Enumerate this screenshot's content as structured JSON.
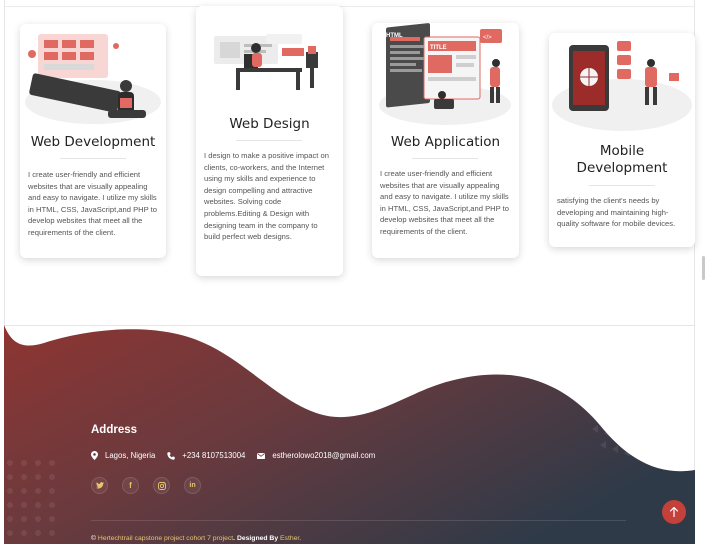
{
  "services": [
    {
      "title": "Web Development",
      "description": "I create user-friendly and efficient websites that are visually appealing and easy to navigate. I utilize my skills in HTML, CSS, JavaScript,and PHP to develop websites that meet all the requirements of the client.",
      "icon": "web-development-illustration"
    },
    {
      "title": "Web Design",
      "description": "I design to make a positive impact on clients, co-workers, and the Internet using my skills and experience to design compelling and attractive websites. Solving code problems.Editing & Design with designing team in the company to build perfect web designs.",
      "icon": "web-design-illustration"
    },
    {
      "title": "Web Application",
      "description": "I create user-friendly and efficient websites that are visually appealing and easy to navigate. I utilize my skills in HTML, CSS, JavaScript,and PHP to develop websites that meet all the requirements of the client.",
      "icon": "web-application-illustration",
      "illustration_labels": [
        "HTML",
        "TITLE",
        "</>"
      ]
    },
    {
      "title": "Mobile Development",
      "description": "satisfying the client's needs by developing and maintaining high-quality software for mobile devices.",
      "icon": "mobile-development-illustration"
    }
  ],
  "footer": {
    "address_title": "Address",
    "location": "Lagos, Nigeria",
    "phone": "+234 8107513004",
    "email": "estherolowo2018@gmail.com",
    "socials": [
      {
        "icon": "twitter-icon",
        "glyph": "🐦"
      },
      {
        "icon": "facebook-icon",
        "glyph": "f"
      },
      {
        "icon": "instagram-icon",
        "glyph": "◎"
      },
      {
        "icon": "linkedin-icon",
        "glyph": "in"
      }
    ],
    "copyright_prefix": "© ",
    "copyright_project": "Hertechtrail capstone project cohort 7 project",
    "copyright_designed": ". Designed By ",
    "copyright_author": "Esther",
    "copyright_end": ".",
    "scroll_top_icon": "arrow-up-icon"
  },
  "colors": {
    "accent_red": "#c4403a",
    "footer_dark": "#3d3a45",
    "footer_red": "#8e3532",
    "gold": "#e7c56b"
  }
}
